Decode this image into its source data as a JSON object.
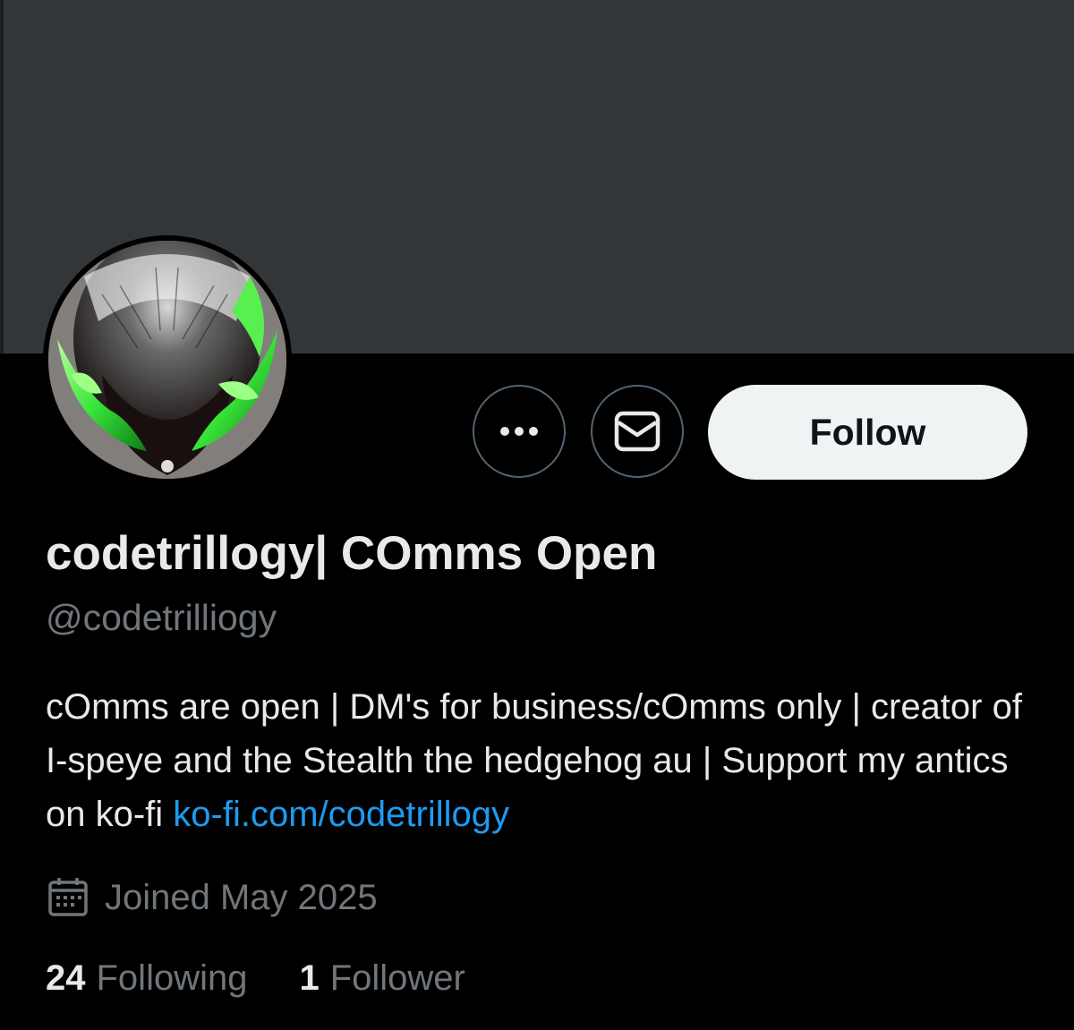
{
  "profile": {
    "display_name": "codetrillogy| COmms Open",
    "handle": "@codetrilliogy",
    "bio_text": "cOmms are open | DM's for business/cOmms only | creator of I-speye and the Stealth the hedgehog au | Support my antics on ko-fi ",
    "bio_link": "ko-fi.com/codetrillogy",
    "joined": "Joined May 2025"
  },
  "actions": {
    "follow_label": "Follow",
    "more_icon": "more-horizontal-icon",
    "message_icon": "envelope-icon"
  },
  "stats": {
    "following_count": "24",
    "following_label": "Following",
    "followers_count": "1",
    "followers_label": "Follower"
  },
  "colors": {
    "background": "#000000",
    "banner": "#333639",
    "text_primary": "#e7e9ea",
    "text_secondary": "#71767b",
    "link": "#1d9bf0",
    "follow_button_bg": "#eff3f4",
    "avatar_accent": "#39e639"
  }
}
